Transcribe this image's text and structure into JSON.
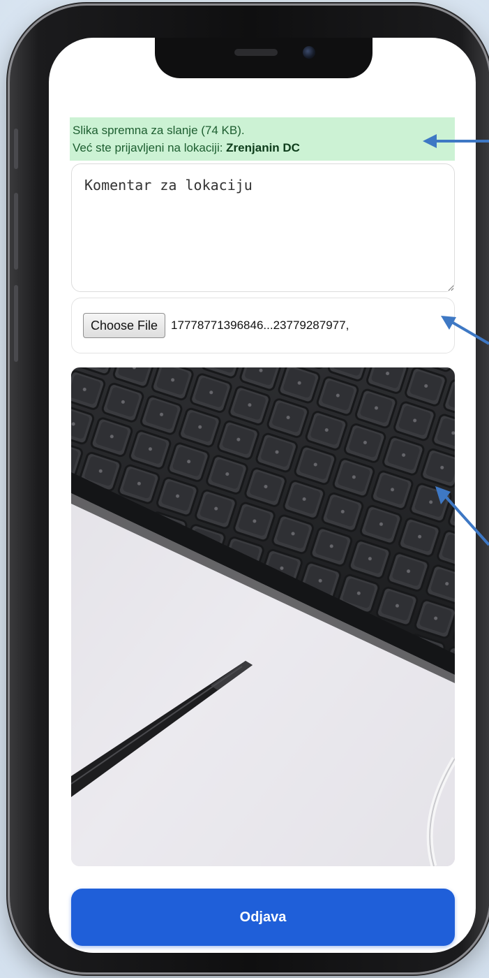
{
  "status": {
    "line1": "Slika spremna za slanje (74 KB).",
    "line2_prefix": "Već ste prijavljeni na lokaciji: ",
    "location": "Zrenjanin DC",
    "bg_color": "#ccf2d4"
  },
  "comment": {
    "placeholder": "Komentar za lokaciju",
    "value": ""
  },
  "file_input": {
    "button_label": "Choose File",
    "file_name": "17778771396846...23779287977,"
  },
  "logout": {
    "label": "Odjava",
    "color": "#1f5fd9"
  },
  "annotation_color": "#3e78c4"
}
